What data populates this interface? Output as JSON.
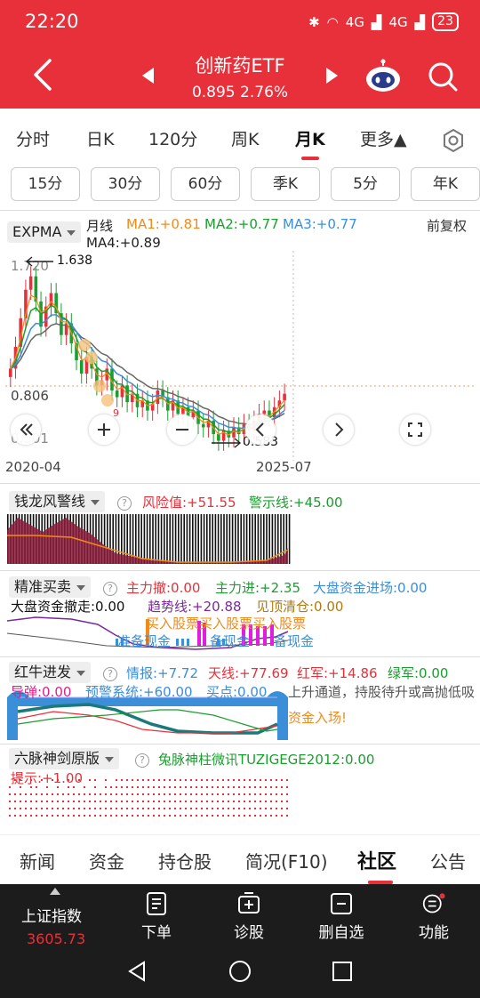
{
  "status": {
    "time": "22:20",
    "net1": "4G",
    "net2": "4G",
    "battery": "23"
  },
  "header": {
    "title": "创新药ETF",
    "price": "0.895",
    "change": "2.76%"
  },
  "period_tabs": [
    "分时",
    "日K",
    "120分",
    "周K",
    "月K",
    "更多▲"
  ],
  "active_period": "月K",
  "minute_tabs": [
    "15分",
    "30分",
    "60分",
    "季K",
    "5分",
    "年K"
  ],
  "kline": {
    "indicator": "EXPMA",
    "period_label": "月线",
    "ma1": "MA1:+0.81",
    "ma2": "MA2:+0.77",
    "ma3": "MA3:+0.77",
    "ma4": "MA4:+0.89",
    "adjust": "前复权",
    "y_top": "1.720",
    "y_mid": "0.806",
    "y_low": "0.501",
    "high_label": "1.638",
    "low_label": "0.583",
    "date_start": "2020-04",
    "date_end": "2025-07",
    "colors": {
      "ma1": "#f08b1b",
      "ma2": "#1a9e2e",
      "ma3": "#3b8ed8",
      "ma4": "#666666",
      "up": "#e8303a",
      "down": "#1a9e2e"
    }
  },
  "panel1": {
    "name": "钱龙风警线",
    "risk": "风险值:+51.55",
    "warn": "警示线:+45.00"
  },
  "panel2": {
    "name": "精准买卖",
    "main_out": "主力撤:0.00",
    "main_in": "主力进:+2.35",
    "market_in": "大盘资金进场:0.00",
    "market_out": "大盘资金撤走:0.00",
    "trend": "趋势线:+20.88",
    "top": "见顶清仓:0.00",
    "buy_text": "买入股票买入股票买入股票",
    "prepare_text": "准备现金",
    "prepare_text2": "备现金",
    "prepare_text3": "备现金"
  },
  "panel3": {
    "name": "红牛进发",
    "info": "情报:+7.72",
    "sky": "天线:+77.69",
    "red": "红军:+14.86",
    "green": "绿军:0.00",
    "missile": "导弹:0.00",
    "alert": "预警系统:+60.00",
    "buy_point": "买点:0.00",
    "note": "上升通道，持股待升或高抛低吸",
    "fund": "资金入场!"
  },
  "panel4": {
    "name": "六脉神剑原版",
    "ad": "兔脉神柱微讯TUZIGEGE2012:0.00",
    "hint": "提示:+1.00"
  },
  "bottom_tabs": [
    "新闻",
    "资金",
    "持仓股",
    "简况(F10)",
    "社区",
    "公告"
  ],
  "active_bottom_tab": "社区",
  "bottombar": {
    "index_name": "上证指数",
    "index_value": "3605.73",
    "items": [
      "下单",
      "诊股",
      "删自选",
      "功能"
    ]
  }
}
